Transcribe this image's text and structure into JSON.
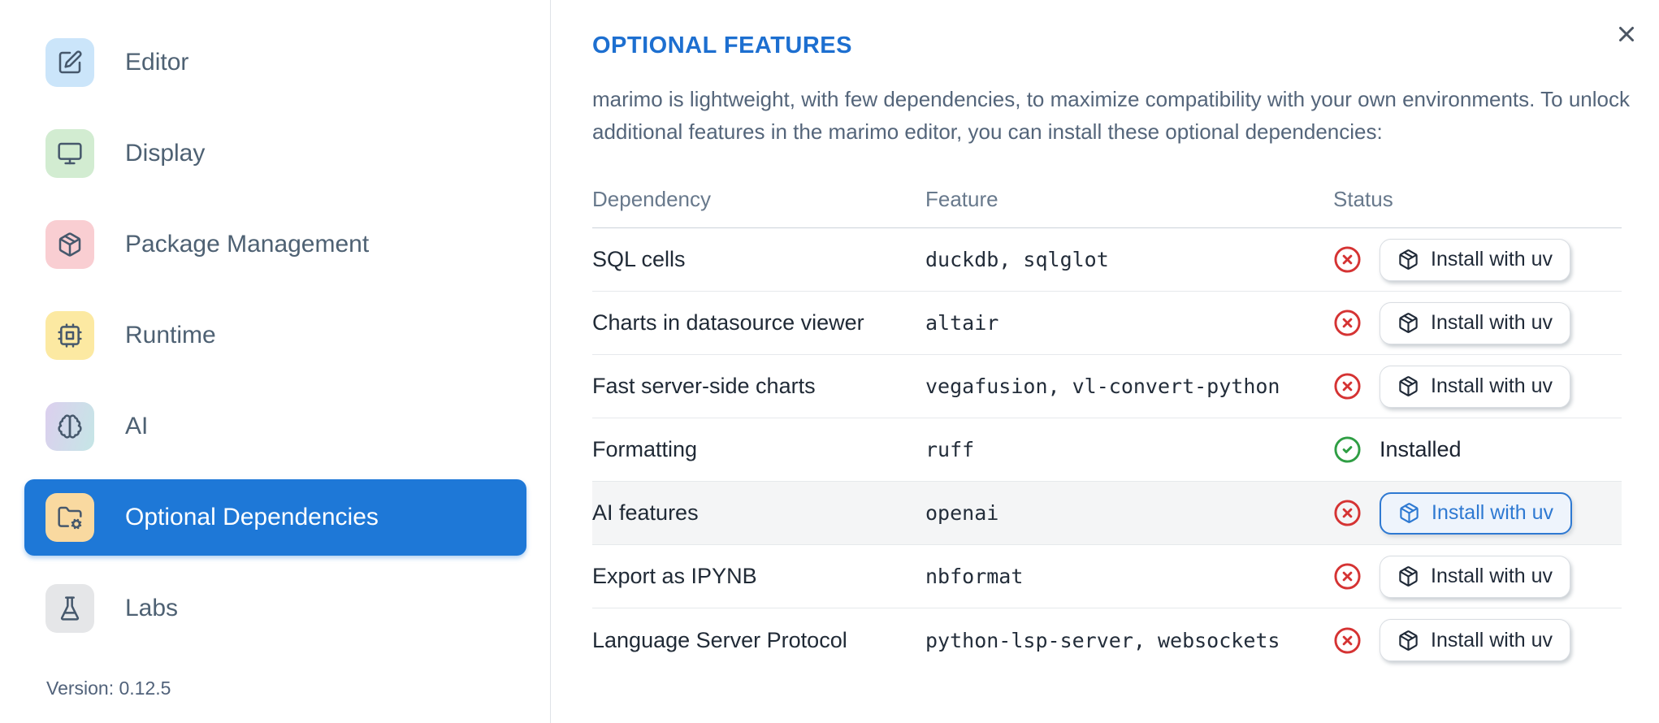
{
  "sidebar": {
    "items": [
      {
        "label": "Editor"
      },
      {
        "label": "Display"
      },
      {
        "label": "Package Management"
      },
      {
        "label": "Runtime"
      },
      {
        "label": "AI"
      },
      {
        "label": "Optional Dependencies",
        "selected": true
      },
      {
        "label": "Labs"
      }
    ],
    "version_label": "Version: 0.12.5"
  },
  "dialog": {
    "title": "OPTIONAL FEATURES",
    "description": "marimo is lightweight, with few dependencies, to maximize compatibility with your own environments. To unlock additional features in the marimo editor, you can install these optional dependencies:"
  },
  "table": {
    "columns": [
      "Dependency",
      "Feature",
      "Status"
    ],
    "rows": [
      {
        "dependency": "SQL cells",
        "feature": "duckdb, sqlglot",
        "status": "not-installed",
        "action": "Install with uv"
      },
      {
        "dependency": "Charts in datasource viewer",
        "feature": "altair",
        "status": "not-installed",
        "action": "Install with uv"
      },
      {
        "dependency": "Fast server-side charts",
        "feature": "vegafusion, vl-convert-python",
        "status": "not-installed",
        "action": "Install with uv"
      },
      {
        "dependency": "Formatting",
        "feature": "ruff",
        "status": "installed",
        "status_label": "Installed"
      },
      {
        "dependency": "AI features",
        "feature": "openai",
        "status": "not-installed",
        "action": "Install with uv",
        "highlighted": true
      },
      {
        "dependency": "Export as IPYNB",
        "feature": "nbformat",
        "status": "not-installed",
        "action": "Install with uv"
      },
      {
        "dependency": "Language Server Protocol",
        "feature": "python-lsp-server, websockets",
        "status": "not-installed",
        "action": "Install with uv"
      }
    ]
  },
  "colors": {
    "accent_blue": "#1e78d7",
    "title_blue": "#1d6fd0",
    "error_red": "#d53333",
    "success_green": "#2f9e44",
    "row_highlight": "#f4f5f6"
  }
}
